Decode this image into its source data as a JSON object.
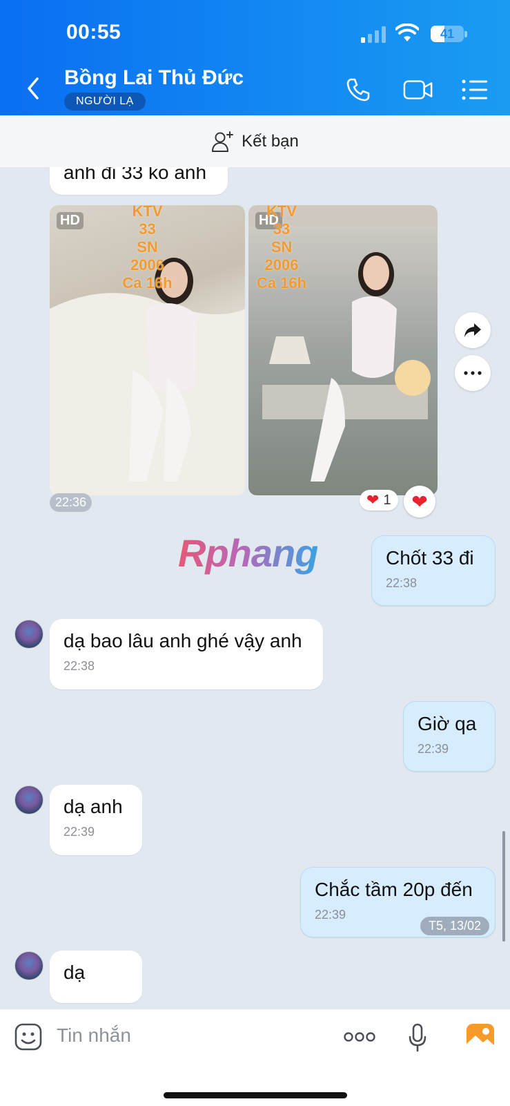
{
  "status_bar": {
    "time": "00:55",
    "battery": "41",
    "battery_level": 0.41
  },
  "header": {
    "contact_name": "Bồng Lai Thủ Đức",
    "badge": "NGƯỜI LẠ"
  },
  "friend_bar": {
    "label": "Kết bạn"
  },
  "chat": {
    "partial_message": "anh đi 33 ko anh",
    "photos": [
      {
        "hd": "HD",
        "caption": [
          "KTV",
          "33",
          "SN",
          "2006",
          "Ca 16h"
        ]
      },
      {
        "hd": "HD",
        "caption": [
          "KTV",
          "33",
          "SN",
          "2006",
          "Ca 16h"
        ]
      }
    ],
    "photos_time": "22:36",
    "reaction_count": "1",
    "watermark": "Rphang",
    "messages": [
      {
        "from": "me",
        "text": "Chốt 33 đi",
        "time": "22:38"
      },
      {
        "from": "them",
        "text": "dạ bao lâu anh ghé vậy anh",
        "time": "22:38"
      },
      {
        "from": "me",
        "text": "Giờ qa",
        "time": "22:39"
      },
      {
        "from": "them",
        "text": "dạ anh",
        "time": "22:39"
      },
      {
        "from": "me",
        "text": "Chắc tầm 20p đến",
        "time": "22:39"
      },
      {
        "from": "them",
        "text": "dạ",
        "time": ""
      }
    ],
    "date_pill": "T5, 13/02"
  },
  "input": {
    "placeholder": "Tin nhắn"
  },
  "colors": {
    "header_start": "#0a6ff2",
    "header_end": "#1a9cf2",
    "my_bubble": "#d7edfd",
    "background": "#e2e8f0"
  }
}
